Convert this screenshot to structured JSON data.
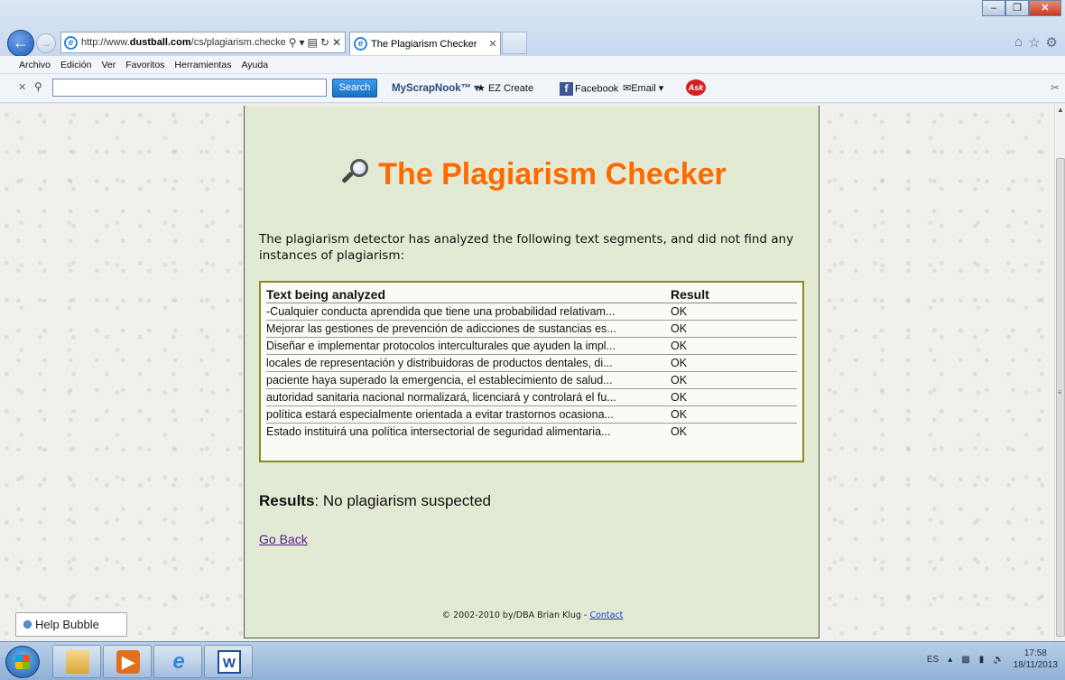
{
  "browser": {
    "url_prefix": "http://www.",
    "url_domain": "dustball.com",
    "url_path": "/cs/plagiarism.checker",
    "tab_title": "The Plagiarism Checker",
    "menu": [
      "Archivo",
      "Edición",
      "Ver",
      "Favoritos",
      "Herramientas",
      "Ayuda"
    ],
    "toolbar": {
      "search_value": "",
      "search_button": "Search",
      "scrapnook": "MyScrapNook™",
      "ez_create": "EZ Create",
      "facebook": "Facebook",
      "email": "Email",
      "ask": "Ask"
    }
  },
  "page": {
    "title": "The Plagiarism Checker",
    "intro": "The plagiarism detector has analyzed the following text segments, and did not find any instances of plagiarism:",
    "table": {
      "headers": [
        "Text being analyzed",
        "Result"
      ],
      "rows": [
        [
          "-Cualquier conducta aprendida que tiene una probabilidad relativam...",
          "OK"
        ],
        [
          "Mejorar las gestiones de prevención de adicciones de sustancias es...",
          "OK"
        ],
        [
          "Diseñar e implementar protocolos interculturales que ayuden la impl...",
          "OK"
        ],
        [
          "locales de representación y distribuidoras de productos dentales, di...",
          "OK"
        ],
        [
          "paciente haya superado la emergencia, el establecimiento de salud...",
          "OK"
        ],
        [
          "autoridad sanitaria nacional normalizará, licenciará y controlará el fu...",
          "OK"
        ],
        [
          "política estará especialmente orientada a evitar trastornos ocasiona...",
          "OK"
        ],
        [
          "Estado instituirá una política intersectorial de seguridad alimentaria...",
          "OK"
        ]
      ]
    },
    "results_label": "Results",
    "results_value": ": No plagiarism suspected",
    "go_back": "Go Back",
    "footer_text": "© 2002-2010 by/DBA Brian Klug - ",
    "footer_link": "Contact"
  },
  "help_bubble": "Help Bubble",
  "taskbar": {
    "language": "ES",
    "time": "17:58",
    "date": "18/11/2013"
  },
  "colors": {
    "title_orange": "#ff6a00",
    "panel_bg": "#e2ead3",
    "table_border": "#8a8a2a",
    "link_visited": "#551a8b"
  }
}
